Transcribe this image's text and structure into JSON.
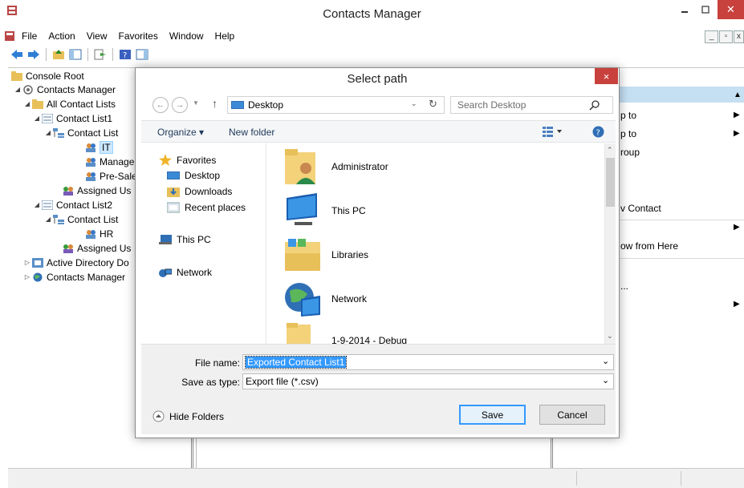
{
  "window": {
    "title": "Contacts Manager",
    "menu": [
      "File",
      "Action",
      "View",
      "Favorites",
      "Window",
      "Help"
    ]
  },
  "tree": {
    "items": [
      {
        "label": "Console Root"
      },
      {
        "label": "Contacts Manager"
      },
      {
        "label": "All Contact Lists"
      },
      {
        "label": "Contact List1"
      },
      {
        "label": "Contact List"
      },
      {
        "label": "IT"
      },
      {
        "label": "Manage"
      },
      {
        "label": "Pre-Sale"
      },
      {
        "label": "Assigned Us"
      },
      {
        "label": "Contact List2"
      },
      {
        "label": "Contact List"
      },
      {
        "label": "HR"
      },
      {
        "label": "Assigned Us"
      },
      {
        "label": "Active Directory Do"
      },
      {
        "label": "Contacts Manager"
      }
    ]
  },
  "actions": {
    "items": [
      "p to",
      "p to",
      "roup",
      "v Contact",
      "ow from Here",
      "..."
    ]
  },
  "dialog": {
    "title": "Select path",
    "close": "×",
    "address": "Desktop",
    "search_placeholder": "Search Desktop",
    "organize": "Organize ▾",
    "new_folder": "New folder",
    "nav": {
      "favorites": "Favorites",
      "desktop": "Desktop",
      "downloads": "Downloads",
      "recent": "Recent places",
      "this_pc": "This PC",
      "network": "Network"
    },
    "files": [
      "Administrator",
      "This PC",
      "Libraries",
      "Network",
      "1-9-2014 - Debug"
    ],
    "file_name_label": "File name:",
    "file_name_value": "Exported Contact List1",
    "save_type_label": "Save as type:",
    "save_type_value": "Export file (*.csv)",
    "hide_folders": "Hide Folders",
    "save": "Save",
    "cancel": "Cancel"
  },
  "colors": {
    "accent": "#3399ff",
    "close_red": "#c8413c",
    "action_header": "#c5dff3"
  }
}
